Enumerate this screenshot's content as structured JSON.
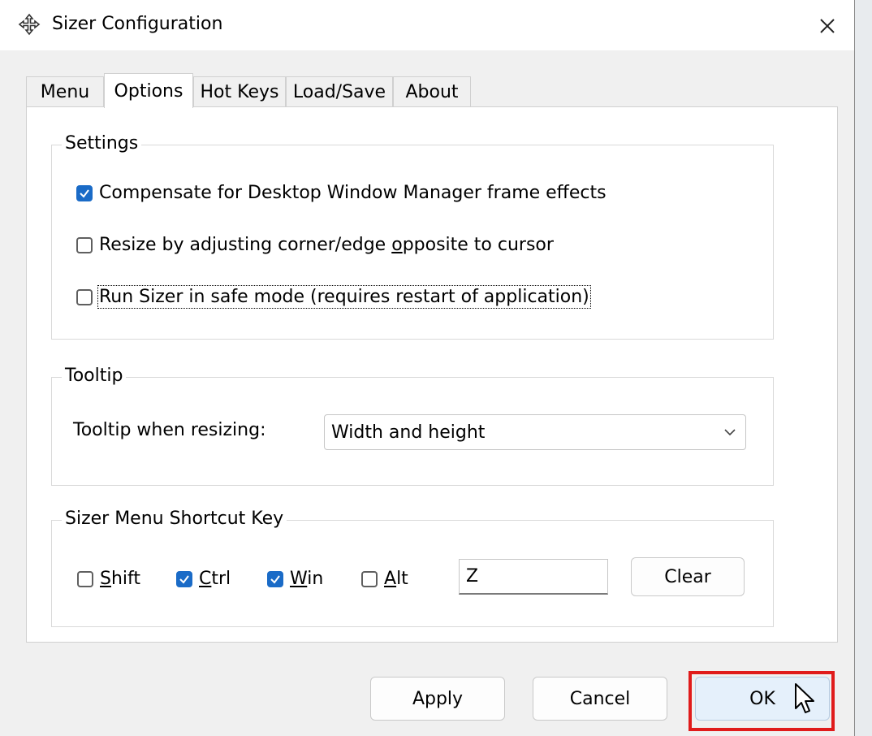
{
  "window": {
    "title": "Sizer Configuration",
    "close_label": "✕"
  },
  "tabs": [
    {
      "label": "Menu"
    },
    {
      "label": "Options"
    },
    {
      "label": "Hot Keys"
    },
    {
      "label": "Load/Save"
    },
    {
      "label": "About"
    }
  ],
  "active_tab": "Options",
  "settings": {
    "title": "Settings",
    "options": [
      {
        "pre": "Compensate for Desktop Window Manager frame effects",
        "u": "",
        "post": "",
        "checked": true
      },
      {
        "pre": "Resize by adjusting corner/edge ",
        "u": "o",
        "post": "pposite to cursor",
        "checked": false
      },
      {
        "pre": "Run Sizer in safe mode (requires restart of application)",
        "u": "",
        "post": "",
        "checked": false
      }
    ]
  },
  "tooltip": {
    "title": "Tooltip",
    "label": "Tooltip when resizing:",
    "selected": "Width and height"
  },
  "shortcut": {
    "title": "Sizer Menu Shortcut Key",
    "keys": [
      {
        "u": "S",
        "rest": "hift",
        "checked": false
      },
      {
        "u": "C",
        "rest": "trl",
        "checked": true
      },
      {
        "u": "W",
        "rest": "in",
        "checked": true
      },
      {
        "u": "A",
        "rest": "lt",
        "checked": false
      }
    ],
    "key_value": "Z",
    "clear_label": "Clear"
  },
  "buttons": {
    "apply": "Apply",
    "cancel": "Cancel",
    "ok": "OK"
  },
  "colors": {
    "accent": "#1a6bc7",
    "highlight": "#e01b1b"
  }
}
